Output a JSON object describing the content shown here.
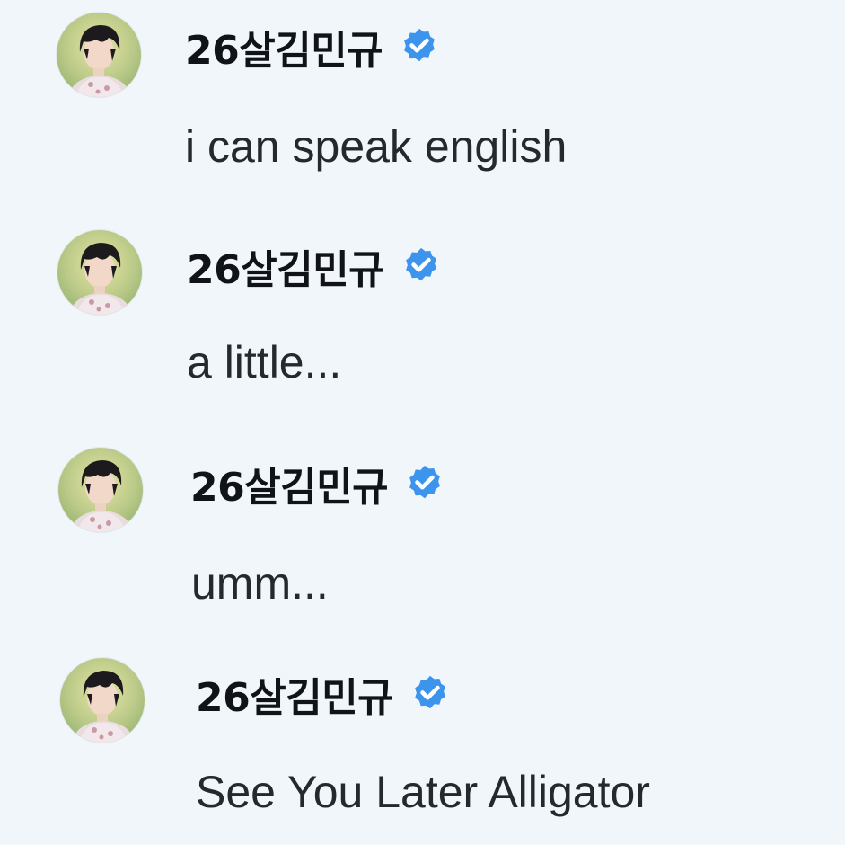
{
  "colors": {
    "background": "#f1f6fb",
    "username": "#101418",
    "message_text": "#24292e",
    "verified_badge": "#3d94ec"
  },
  "icons": {
    "verified": "verified-badge-icon",
    "avatar": "profile-avatar"
  },
  "messages": [
    {
      "username": "26살김민규",
      "text": "i can speak english"
    },
    {
      "username": "26살김민규",
      "text": "a little..."
    },
    {
      "username": "26살김민규",
      "text": "umm..."
    },
    {
      "username": "26살김민규",
      "text": "See You Later Alligator"
    }
  ]
}
